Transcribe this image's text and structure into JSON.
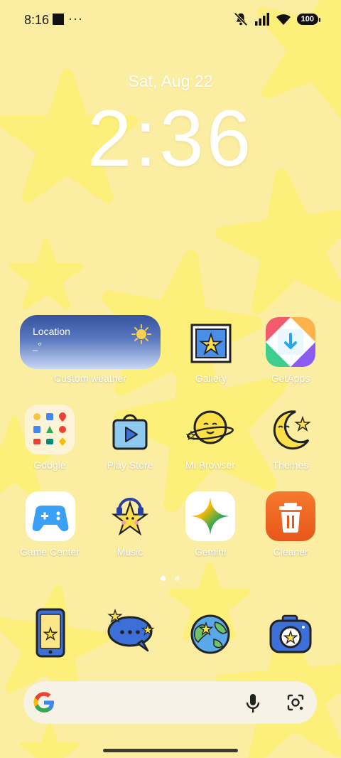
{
  "status_bar": {
    "time": "8:16",
    "dots": "···",
    "battery": "100",
    "icons": [
      "notification-square-icon",
      "more-dots-icon",
      "mute-icon",
      "signal-icon",
      "wifi-icon",
      "battery-icon"
    ]
  },
  "lockscreen": {
    "date": "Sat, Aug 22",
    "time": "2:36"
  },
  "weather_widget": {
    "location": "Location",
    "temp": "_°",
    "label": "Custom weather"
  },
  "apps_row1": [
    {
      "label": "Gallery",
      "icon": "gallery-icon"
    },
    {
      "label": "GetApps",
      "icon": "getapps-icon"
    }
  ],
  "apps_row2": [
    {
      "label": "Google",
      "icon": "google-folder-icon"
    },
    {
      "label": "Play Store",
      "icon": "play-store-icon"
    },
    {
      "label": "Mi Browser",
      "icon": "mi-browser-icon"
    },
    {
      "label": "Themes",
      "icon": "themes-icon"
    }
  ],
  "apps_row3": [
    {
      "label": "Game Center",
      "icon": "game-center-icon"
    },
    {
      "label": "Music",
      "icon": "music-icon"
    },
    {
      "label": "Gemini",
      "icon": "gemini-icon"
    },
    {
      "label": "Cleaner",
      "icon": "cleaner-icon"
    }
  ],
  "page_indicator": {
    "count": 2,
    "active": 0
  },
  "dock": [
    {
      "name": "phone-icon"
    },
    {
      "name": "messages-icon"
    },
    {
      "name": "globe-icon"
    },
    {
      "name": "camera-icon"
    }
  ],
  "search_bar": {
    "icons": [
      "google-logo-icon",
      "microphone-icon",
      "lens-icon"
    ]
  },
  "colors": {
    "wallpaper": "#fbeda1",
    "star": "#fdf07a",
    "accent_blue": "#3c6fd8"
  }
}
